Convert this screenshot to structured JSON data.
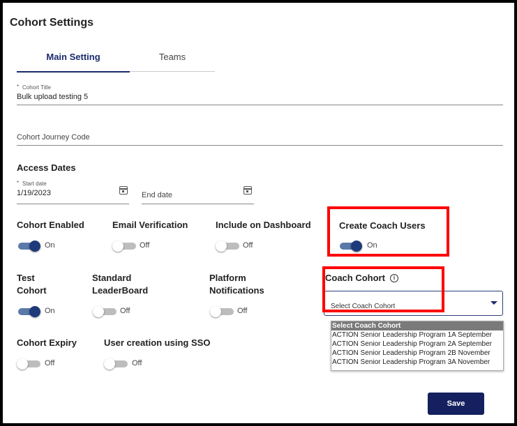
{
  "page": {
    "title": "Cohort Settings"
  },
  "tabs": {
    "main": "Main Setting",
    "teams": "Teams"
  },
  "cohort_title": {
    "label": "Cohort Title",
    "required_mark": "*",
    "value": "Bulk upload testing 5"
  },
  "journey_code": {
    "placeholder": "Cohort Journey Code"
  },
  "access_dates": {
    "heading": "Access Dates",
    "start_label": "Start date",
    "start_value": "1/19/2023",
    "end_placeholder": "End date"
  },
  "toggles": {
    "cohort_enabled": {
      "label": "Cohort Enabled",
      "state": "On"
    },
    "email_verification": {
      "label": "Email Verification",
      "state": "Off"
    },
    "include_dashboard": {
      "label": "Include on Dashboard",
      "state": "Off"
    },
    "create_coach_users": {
      "label": "Create Coach Users",
      "state": "On"
    },
    "test_cohort": {
      "label_line1": "Test",
      "label_line2": "Cohort",
      "state": "On"
    },
    "standard_leaderboard": {
      "label_line1": "Standard",
      "label_line2": "LeaderBoard",
      "state": "Off"
    },
    "platform_notifications": {
      "label_line1": "Platform",
      "label_line2": "Notifications",
      "state": "Off"
    },
    "cohort_expiry": {
      "label": "Cohort Expiry",
      "state": "Off"
    },
    "sso_user_creation": {
      "label": "User creation using SSO",
      "state": "Off"
    }
  },
  "coach_cohort": {
    "label": "Coach Cohort",
    "info_icon": "info-circle-icon",
    "selected": "Select Coach Cohort",
    "options": [
      "Select Coach Cohort",
      "ACTION Senior Leadership Program 1A September",
      "ACTION Senior Leadership Program 2A September",
      "ACTION Senior Leadership Program 2B November",
      "ACTION Senior Leadership Program 3A November"
    ]
  },
  "actions": {
    "save": "Save"
  },
  "colors": {
    "primary": "#14205f",
    "toggle_on": "#1f3a7a",
    "highlight": "#ff0000"
  }
}
